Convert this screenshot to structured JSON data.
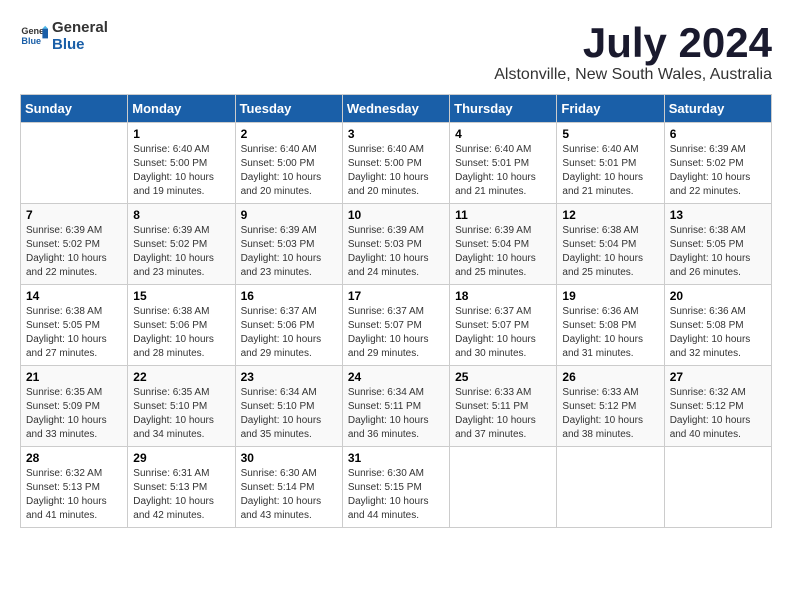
{
  "logo": {
    "text_general": "General",
    "text_blue": "Blue"
  },
  "title": "July 2024",
  "subtitle": "Alstonville, New South Wales, Australia",
  "weekdays": [
    "Sunday",
    "Monday",
    "Tuesday",
    "Wednesday",
    "Thursday",
    "Friday",
    "Saturday"
  ],
  "weeks": [
    [
      {
        "day": "",
        "sunrise": "",
        "sunset": "",
        "daylight": ""
      },
      {
        "day": "1",
        "sunrise": "Sunrise: 6:40 AM",
        "sunset": "Sunset: 5:00 PM",
        "daylight": "Daylight: 10 hours and 19 minutes."
      },
      {
        "day": "2",
        "sunrise": "Sunrise: 6:40 AM",
        "sunset": "Sunset: 5:00 PM",
        "daylight": "Daylight: 10 hours and 20 minutes."
      },
      {
        "day": "3",
        "sunrise": "Sunrise: 6:40 AM",
        "sunset": "Sunset: 5:00 PM",
        "daylight": "Daylight: 10 hours and 20 minutes."
      },
      {
        "day": "4",
        "sunrise": "Sunrise: 6:40 AM",
        "sunset": "Sunset: 5:01 PM",
        "daylight": "Daylight: 10 hours and 21 minutes."
      },
      {
        "day": "5",
        "sunrise": "Sunrise: 6:40 AM",
        "sunset": "Sunset: 5:01 PM",
        "daylight": "Daylight: 10 hours and 21 minutes."
      },
      {
        "day": "6",
        "sunrise": "Sunrise: 6:39 AM",
        "sunset": "Sunset: 5:02 PM",
        "daylight": "Daylight: 10 hours and 22 minutes."
      }
    ],
    [
      {
        "day": "7",
        "sunrise": "Sunrise: 6:39 AM",
        "sunset": "Sunset: 5:02 PM",
        "daylight": "Daylight: 10 hours and 22 minutes."
      },
      {
        "day": "8",
        "sunrise": "Sunrise: 6:39 AM",
        "sunset": "Sunset: 5:02 PM",
        "daylight": "Daylight: 10 hours and 23 minutes."
      },
      {
        "day": "9",
        "sunrise": "Sunrise: 6:39 AM",
        "sunset": "Sunset: 5:03 PM",
        "daylight": "Daylight: 10 hours and 23 minutes."
      },
      {
        "day": "10",
        "sunrise": "Sunrise: 6:39 AM",
        "sunset": "Sunset: 5:03 PM",
        "daylight": "Daylight: 10 hours and 24 minutes."
      },
      {
        "day": "11",
        "sunrise": "Sunrise: 6:39 AM",
        "sunset": "Sunset: 5:04 PM",
        "daylight": "Daylight: 10 hours and 25 minutes."
      },
      {
        "day": "12",
        "sunrise": "Sunrise: 6:38 AM",
        "sunset": "Sunset: 5:04 PM",
        "daylight": "Daylight: 10 hours and 25 minutes."
      },
      {
        "day": "13",
        "sunrise": "Sunrise: 6:38 AM",
        "sunset": "Sunset: 5:05 PM",
        "daylight": "Daylight: 10 hours and 26 minutes."
      }
    ],
    [
      {
        "day": "14",
        "sunrise": "Sunrise: 6:38 AM",
        "sunset": "Sunset: 5:05 PM",
        "daylight": "Daylight: 10 hours and 27 minutes."
      },
      {
        "day": "15",
        "sunrise": "Sunrise: 6:38 AM",
        "sunset": "Sunset: 5:06 PM",
        "daylight": "Daylight: 10 hours and 28 minutes."
      },
      {
        "day": "16",
        "sunrise": "Sunrise: 6:37 AM",
        "sunset": "Sunset: 5:06 PM",
        "daylight": "Daylight: 10 hours and 29 minutes."
      },
      {
        "day": "17",
        "sunrise": "Sunrise: 6:37 AM",
        "sunset": "Sunset: 5:07 PM",
        "daylight": "Daylight: 10 hours and 29 minutes."
      },
      {
        "day": "18",
        "sunrise": "Sunrise: 6:37 AM",
        "sunset": "Sunset: 5:07 PM",
        "daylight": "Daylight: 10 hours and 30 minutes."
      },
      {
        "day": "19",
        "sunrise": "Sunrise: 6:36 AM",
        "sunset": "Sunset: 5:08 PM",
        "daylight": "Daylight: 10 hours and 31 minutes."
      },
      {
        "day": "20",
        "sunrise": "Sunrise: 6:36 AM",
        "sunset": "Sunset: 5:08 PM",
        "daylight": "Daylight: 10 hours and 32 minutes."
      }
    ],
    [
      {
        "day": "21",
        "sunrise": "Sunrise: 6:35 AM",
        "sunset": "Sunset: 5:09 PM",
        "daylight": "Daylight: 10 hours and 33 minutes."
      },
      {
        "day": "22",
        "sunrise": "Sunrise: 6:35 AM",
        "sunset": "Sunset: 5:10 PM",
        "daylight": "Daylight: 10 hours and 34 minutes."
      },
      {
        "day": "23",
        "sunrise": "Sunrise: 6:34 AM",
        "sunset": "Sunset: 5:10 PM",
        "daylight": "Daylight: 10 hours and 35 minutes."
      },
      {
        "day": "24",
        "sunrise": "Sunrise: 6:34 AM",
        "sunset": "Sunset: 5:11 PM",
        "daylight": "Daylight: 10 hours and 36 minutes."
      },
      {
        "day": "25",
        "sunrise": "Sunrise: 6:33 AM",
        "sunset": "Sunset: 5:11 PM",
        "daylight": "Daylight: 10 hours and 37 minutes."
      },
      {
        "day": "26",
        "sunrise": "Sunrise: 6:33 AM",
        "sunset": "Sunset: 5:12 PM",
        "daylight": "Daylight: 10 hours and 38 minutes."
      },
      {
        "day": "27",
        "sunrise": "Sunrise: 6:32 AM",
        "sunset": "Sunset: 5:12 PM",
        "daylight": "Daylight: 10 hours and 40 minutes."
      }
    ],
    [
      {
        "day": "28",
        "sunrise": "Sunrise: 6:32 AM",
        "sunset": "Sunset: 5:13 PM",
        "daylight": "Daylight: 10 hours and 41 minutes."
      },
      {
        "day": "29",
        "sunrise": "Sunrise: 6:31 AM",
        "sunset": "Sunset: 5:13 PM",
        "daylight": "Daylight: 10 hours and 42 minutes."
      },
      {
        "day": "30",
        "sunrise": "Sunrise: 6:30 AM",
        "sunset": "Sunset: 5:14 PM",
        "daylight": "Daylight: 10 hours and 43 minutes."
      },
      {
        "day": "31",
        "sunrise": "Sunrise: 6:30 AM",
        "sunset": "Sunset: 5:15 PM",
        "daylight": "Daylight: 10 hours and 44 minutes."
      },
      {
        "day": "",
        "sunrise": "",
        "sunset": "",
        "daylight": ""
      },
      {
        "day": "",
        "sunrise": "",
        "sunset": "",
        "daylight": ""
      },
      {
        "day": "",
        "sunrise": "",
        "sunset": "",
        "daylight": ""
      }
    ]
  ]
}
